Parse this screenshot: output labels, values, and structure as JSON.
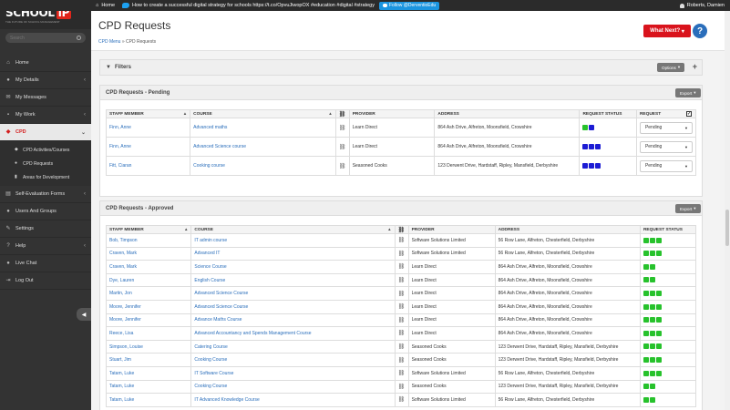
{
  "topbar": {
    "home": "Home",
    "tweet": "How to create a successful digital strategy for schools https://t.co/OpvuJiwopOX #education #digital #strategy",
    "follow": "Follow @DerventioEdu",
    "user": "Roberts, Damien"
  },
  "brand": {
    "name": "SCHOOL",
    "ip": "iP",
    "tagline": "THE FUTURE OF SCHOOL MANAGEMENT"
  },
  "search": {
    "placeholder": "Search"
  },
  "nav": [
    {
      "label": "Home"
    },
    {
      "label": "My Details"
    },
    {
      "label": "My Messages"
    },
    {
      "label": "My Work"
    },
    {
      "label": "CPD"
    }
  ],
  "cpd_sub": [
    {
      "label": "CPD Activities/Courses"
    },
    {
      "label": "CPD Requests"
    },
    {
      "label": "Areas for Development"
    }
  ],
  "nav2": [
    {
      "label": "Self-Evaluation Forms"
    },
    {
      "label": "Users And Groups"
    },
    {
      "label": "Settings"
    },
    {
      "label": "Help"
    },
    {
      "label": "Live Chat"
    },
    {
      "label": "Log Out"
    }
  ],
  "page": {
    "title": "CPD Requests",
    "crumb_link": "CPD Menu",
    "crumb_sep": " » ",
    "crumb_current": "CPD Requests",
    "what_next": "What Next?",
    "help": "?"
  },
  "filters": {
    "title": "Filters",
    "options": "Options"
  },
  "pending": {
    "title": "CPD Requests - Pending",
    "export": "Export",
    "headers": [
      "STAFF MEMBER",
      "COURSE",
      "PROVIDER",
      "ADDRESS",
      "REQUEST STATUS",
      "REQUEST"
    ],
    "rows": [
      {
        "staff": "Finn, Anne",
        "course": "Advanced maths",
        "provider": "Learn Direct",
        "address": "864 Ash Drive, Alfreton, Moonsfield, Crowshire",
        "status": [
          "g",
          "b"
        ],
        "request": "Pending"
      },
      {
        "staff": "Finn, Anne",
        "course": "Advanced Science course",
        "provider": "Learn Direct",
        "address": "864 Ash Drive, Alfreton, Moonsfield, Crowshire",
        "status": [
          "b",
          "b",
          "b"
        ],
        "request": "Pending"
      },
      {
        "staff": "Fitt, Ciaran",
        "course": "Cooking course",
        "provider": "Seasoned Cooks",
        "address": "123 Derwent Drive, Hardstaff, Ripley, Mansfield, Derbyshire",
        "status": [
          "b",
          "b",
          "b"
        ],
        "request": "Pending"
      }
    ]
  },
  "approved": {
    "title": "CPD Requests - Approved",
    "export": "Export",
    "headers": [
      "STAFF MEMBER",
      "COURSE",
      "PROVIDER",
      "ADDRESS",
      "REQUEST STATUS"
    ],
    "rows": [
      {
        "staff": "Bob, Timpson",
        "course": "IT admin course",
        "provider": "Software Solutions Limited",
        "address": "56 Row Lane, Alfreton, Chesterfield, Derbyshire",
        "status": [
          "g",
          "g",
          "g"
        ]
      },
      {
        "staff": "Craven, Mark",
        "course": "Advanced IT",
        "provider": "Software Solutions Limited",
        "address": "56 Row Lane, Alfreton, Chesterfield, Derbyshire",
        "status": [
          "g",
          "g",
          "g"
        ]
      },
      {
        "staff": "Craven, Mark",
        "course": "Science Course",
        "provider": "Learn Direct",
        "address": "864 Ash Drive, Alfreton, Moonsfield, Crowshire",
        "status": [
          "g",
          "g"
        ]
      },
      {
        "staff": "Dye, Lauren",
        "course": "English Course",
        "provider": "Learn Direct",
        "address": "864 Ash Drive, Alfreton, Moonsfield, Crowshire",
        "status": [
          "g",
          "g"
        ]
      },
      {
        "staff": "Martin, Jon",
        "course": "Advanced Science Course",
        "provider": "Learn Direct",
        "address": "864 Ash Drive, Alfreton, Moonsfield, Crowshire",
        "status": [
          "g",
          "g",
          "g"
        ]
      },
      {
        "staff": "Moore, Jennifer",
        "course": "Advanced Science Course",
        "provider": "Learn Direct",
        "address": "864 Ash Drive, Alfreton, Moonsfield, Crowshire",
        "status": [
          "g",
          "g",
          "g"
        ]
      },
      {
        "staff": "Moore, Jennifer",
        "course": "Advance Maths Course",
        "provider": "Learn Direct",
        "address": "864 Ash Drive, Alfreton, Moonsfield, Crowshire",
        "status": [
          "g",
          "g",
          "g"
        ]
      },
      {
        "staff": "Reece, Lisa",
        "course": "Advanced Accountancy and Spends Management Course",
        "provider": "Learn Direct",
        "address": "864 Ash Drive, Alfreton, Moonsfield, Crowshire",
        "status": [
          "g",
          "g",
          "g"
        ]
      },
      {
        "staff": "Simpson, Louise",
        "course": "Catering Course",
        "provider": "Seasoned Cooks",
        "address": "123 Derwent Drive, Hardstaff, Ripley, Mansfield, Derbyshire",
        "status": [
          "g",
          "g",
          "g"
        ]
      },
      {
        "staff": "Stuart, Jim",
        "course": "Cooking Course",
        "provider": "Seasoned Cooks",
        "address": "123 Derwent Drive, Hardstaff, Ripley, Mansfield, Derbyshire",
        "status": [
          "g",
          "g",
          "g"
        ]
      },
      {
        "staff": "Tatam, Luke",
        "course": "IT Software Course",
        "provider": "Software Solutions Limited",
        "address": "56 Row Lane, Alfreton, Chesterfield, Derbyshire",
        "status": [
          "g",
          "g",
          "g"
        ]
      },
      {
        "staff": "Tatam, Luke",
        "course": "Cooking Course",
        "provider": "Seasoned Cooks",
        "address": "123 Derwent Drive, Hardstaff, Ripley, Mansfield, Derbyshire",
        "status": [
          "g",
          "g"
        ]
      },
      {
        "staff": "Tatam, Luke",
        "course": "IT Advanced Knowledge Course",
        "provider": "Software Solutions Limited",
        "address": "56 Row Lane, Alfreton, Chesterfield, Derbyshire",
        "status": [
          "g",
          "g"
        ]
      }
    ]
  },
  "colors": {
    "accent_red": "#d9131c",
    "link_blue": "#2a6ebb",
    "status_green": "#27c22c",
    "status_blue": "#1c1cd4"
  }
}
